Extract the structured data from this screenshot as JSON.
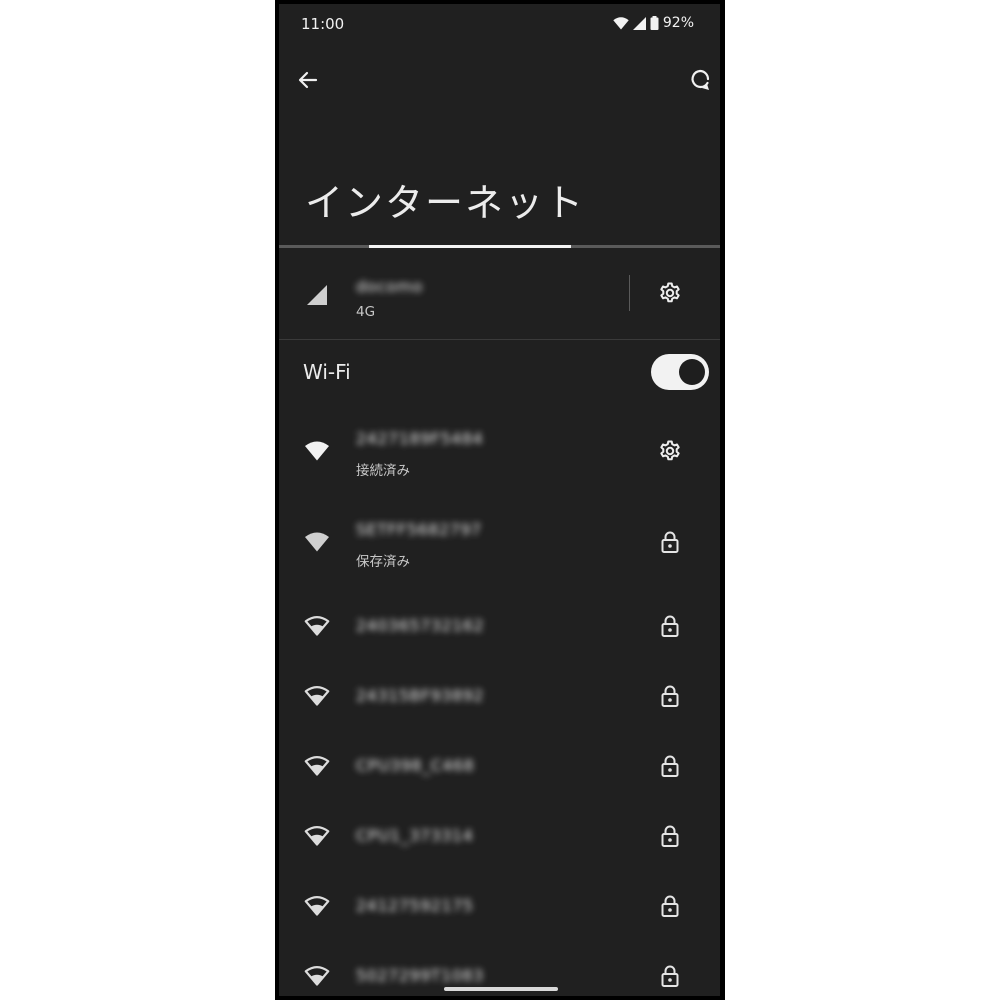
{
  "status_bar": {
    "time": "11:00",
    "battery": "92%",
    "icons": [
      "wifi-icon",
      "cellular-signal-icon",
      "battery-icon"
    ]
  },
  "toolbar": {
    "back_icon": "back-arrow-icon",
    "help_icon": "help-refresh-icon"
  },
  "page": {
    "title": "インターネット",
    "loading_progress_fraction": 0.46
  },
  "mobile": {
    "name": "docomo",
    "network_type": "4G",
    "icon": "cellular-signal-icon",
    "action_icon": "gear-icon"
  },
  "wifi": {
    "label": "Wi-Fi",
    "enabled": true,
    "networks": [
      {
        "ssid": "2427189F5484",
        "status": "接続済み",
        "signal": "full",
        "action": "gear-icon"
      },
      {
        "ssid": "SETFF5682797",
        "status": "保存済み",
        "signal": "full",
        "action": "lock-icon"
      },
      {
        "ssid": "240365732162",
        "status": "",
        "signal": "outline",
        "action": "lock-icon"
      },
      {
        "ssid": "24315BF93892",
        "status": "",
        "signal": "outline",
        "action": "lock-icon"
      },
      {
        "ssid": "CPU398_C468",
        "status": "",
        "signal": "outline",
        "action": "lock-icon"
      },
      {
        "ssid": "CPU1_373314",
        "status": "",
        "signal": "outline",
        "action": "lock-icon"
      },
      {
        "ssid": "24127592175",
        "status": "",
        "signal": "outline",
        "action": "lock-icon"
      },
      {
        "ssid": "5027299T1083",
        "status": "",
        "signal": "outline",
        "action": "lock-icon"
      }
    ]
  },
  "colors": {
    "background": "#202020",
    "text": "#ececec",
    "toggle_on": "#f2f2f2"
  }
}
